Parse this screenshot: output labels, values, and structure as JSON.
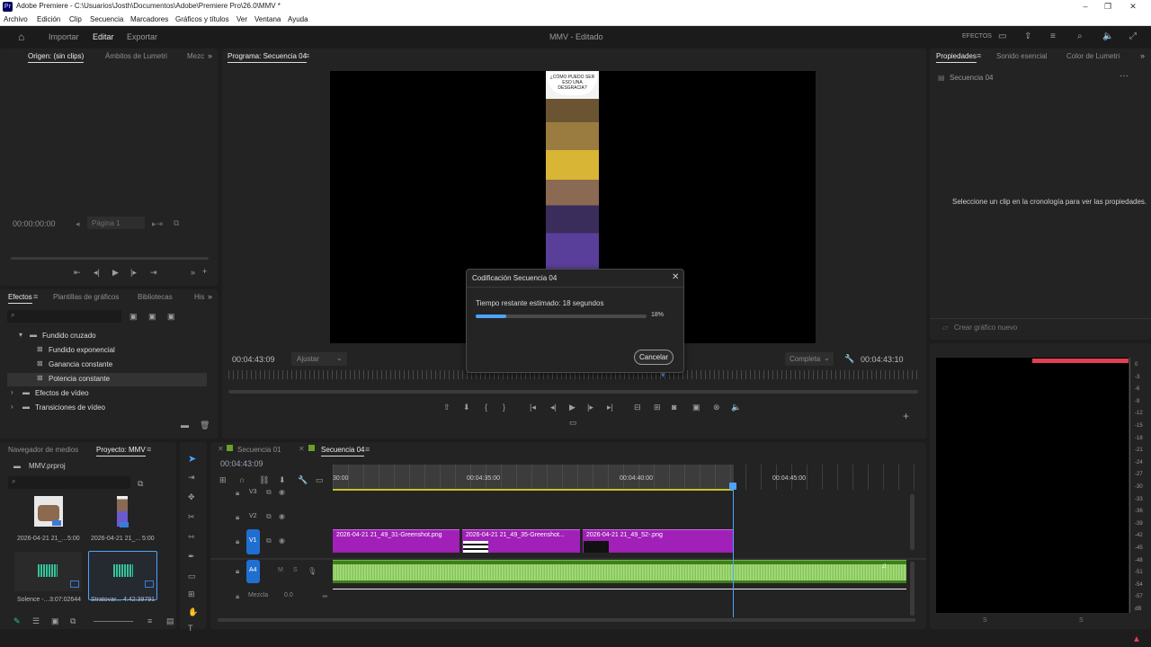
{
  "window": {
    "logo": "Pr",
    "title": "Adobe Premiere - C:\\Usuarios\\Josth\\Documentos\\Adobe\\Premiere Pro\\26.0\\MMV *"
  },
  "menu": [
    "Archivo",
    "Edición",
    "Clip",
    "Secuencia",
    "Marcadores",
    "Gráficos y títulos",
    "Ver",
    "Ventana",
    "Ayuda"
  ],
  "workspace": {
    "import": "Importar",
    "edit": "Editar",
    "export": "Exportar",
    "project_title": "MMV - Editado",
    "effects_label": "EFECTOS"
  },
  "source_panel": {
    "tabs": [
      "Origen: (sin clips)",
      "Ámbitos de Lumetri",
      "Mezc"
    ],
    "timecode": "00:00:00:00",
    "page_field": "Página 1"
  },
  "program_panel": {
    "tab": "Programa: Secuencia 04",
    "comic_text": "¿CÓMO PUEDO SER ESO UNA DESGRACIA?",
    "timecode_left": "00:04:43:09",
    "fit_select": "Ajustar",
    "quality_select": "Completa",
    "timecode_right": "00:04:43:10"
  },
  "dialog": {
    "title": "Codificación Secuencia 04",
    "remaining": "Tiempo restante estimado: 18 segundos",
    "progress_percent": 18,
    "progress_label": "18%",
    "cancel": "Cancelar"
  },
  "properties_panel": {
    "tabs": [
      "Propiedades",
      "Sonido esencial",
      "Color de Lumetri"
    ],
    "sequence": "Secuencia 04",
    "hint": "Seleccione un clip en la cronología para ver las propiedades.",
    "new_graphic": "Crear gráfico nuevo"
  },
  "effects_panel": {
    "tabs": [
      "Efectos",
      "Plantillas de gráficos",
      "Bibliotecas",
      "His"
    ],
    "tree": [
      {
        "label": "Fundido cruzado",
        "type": "folder",
        "level": 1
      },
      {
        "label": "Fundido exponencial",
        "type": "effect",
        "level": 2
      },
      {
        "label": "Ganancia constante",
        "type": "effect",
        "level": 2
      },
      {
        "label": "Potencia constante",
        "type": "effect",
        "level": 2
      },
      {
        "label": "Efectos de vídeo",
        "type": "folder",
        "level": 0
      },
      {
        "label": "Transiciones de vídeo",
        "type": "folder",
        "level": 0
      }
    ]
  },
  "project_panel": {
    "tabs": [
      "Navegador de medios",
      "Proyecto: MMV"
    ],
    "file": "MMV.prproj",
    "items": [
      {
        "name": "2026-04-21 21_...",
        "duration": "5:00"
      },
      {
        "name": "2026-04-21 21_...",
        "duration": "5:00"
      },
      {
        "name": "Solence -...",
        "duration": "3:07:02644"
      },
      {
        "name": "Stratovar...",
        "duration": "4:42:39791"
      }
    ]
  },
  "timeline": {
    "tabs": [
      "Secuencia 01",
      "Secuencia 04"
    ],
    "timecode": "00:04:43:09",
    "ruler": [
      "30:00",
      "00:04:35:00",
      "00:04:40:00",
      "00:04:45:00"
    ],
    "tracks": [
      "V3",
      "V2",
      "V1",
      "A4"
    ],
    "mix_label": "Mezcla",
    "mix_value": "0.0",
    "clips": [
      "2026-04-21 21_49_31-Greenshot.png",
      "2026-04-21 21_49_35-Greenshot...",
      "2026-04-21 21_49_52-.png"
    ]
  },
  "meter": {
    "scale": [
      "0",
      "-3",
      "-6",
      "-9",
      "-12",
      "-15",
      "-18",
      "-21",
      "-24",
      "-27",
      "-30",
      "-33",
      "-36",
      "-39",
      "-42",
      "-45",
      "-48",
      "-51",
      "-54",
      "-57",
      "dB"
    ],
    "bottom_labels": [
      "S",
      "S"
    ]
  },
  "colors": {
    "accent": "#4da3ff",
    "video_clip": "#a020b8",
    "audio_clip": "#4e9a2a",
    "meter_peak": "#e04050"
  }
}
